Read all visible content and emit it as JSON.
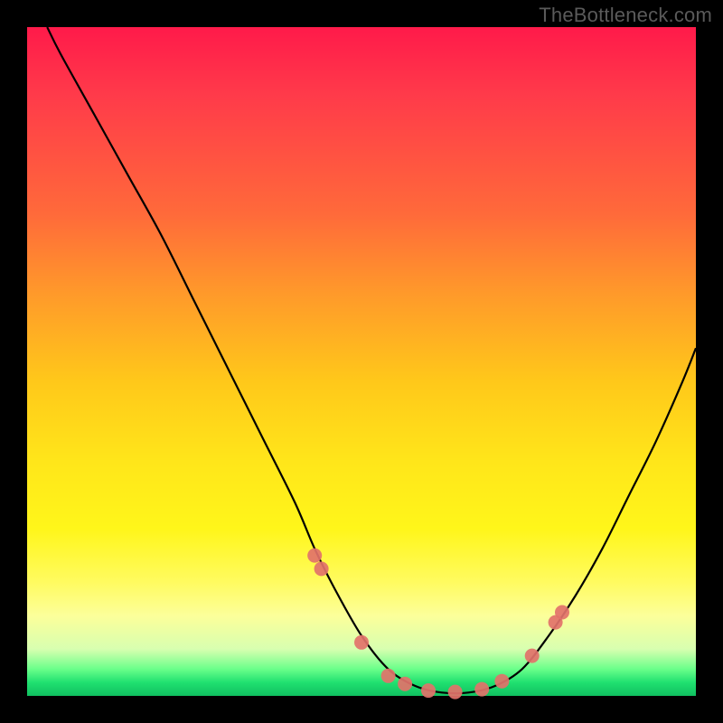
{
  "attribution": "TheBottleneck.com",
  "colors": {
    "background": "#000000",
    "gradient_top": "#ff1a4a",
    "gradient_mid": "#ffe61a",
    "gradient_bottom": "#20e070",
    "curve": "#000000",
    "markers": "#e2726a"
  },
  "chart_data": {
    "type": "line",
    "title": "",
    "xlabel": "",
    "ylabel": "",
    "xlim": [
      0,
      1
    ],
    "ylim": [
      0,
      1
    ],
    "note": "No axis ticks or numeric labels visible; x and y are normalized 0–1 from image pixels. y=0 is bottom (green), y=1 is top (red). Lower y = better (less bottleneck).",
    "series": [
      {
        "name": "bottleneck-curve",
        "x": [
          0.03,
          0.05,
          0.1,
          0.15,
          0.2,
          0.25,
          0.3,
          0.35,
          0.4,
          0.43,
          0.46,
          0.5,
          0.54,
          0.58,
          0.62,
          0.66,
          0.7,
          0.74,
          0.78,
          0.82,
          0.86,
          0.9,
          0.94,
          0.98,
          1.0
        ],
        "y": [
          1.0,
          0.96,
          0.87,
          0.78,
          0.69,
          0.59,
          0.49,
          0.39,
          0.29,
          0.22,
          0.16,
          0.09,
          0.04,
          0.015,
          0.005,
          0.005,
          0.015,
          0.04,
          0.09,
          0.15,
          0.22,
          0.3,
          0.38,
          0.47,
          0.52
        ]
      }
    ],
    "markers": {
      "name": "highlighted-points",
      "x": [
        0.43,
        0.44,
        0.5,
        0.54,
        0.565,
        0.6,
        0.64,
        0.68,
        0.71,
        0.755,
        0.79,
        0.8
      ],
      "y": [
        0.21,
        0.19,
        0.08,
        0.03,
        0.018,
        0.008,
        0.006,
        0.01,
        0.022,
        0.06,
        0.11,
        0.125
      ]
    }
  }
}
